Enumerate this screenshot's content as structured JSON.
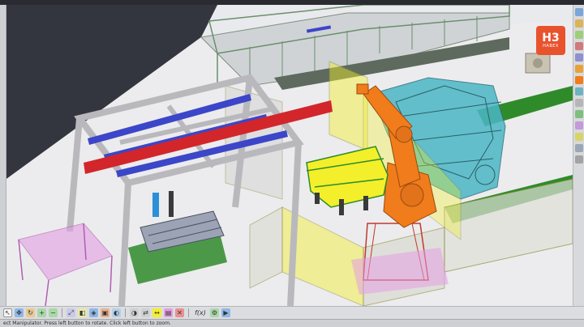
{
  "logo": {
    "mark": "H3",
    "caption": "HABEX"
  },
  "status_bar": {
    "text": "ect Manipulator. Press left button to rotate. Click left button to zoom."
  },
  "bottom_toolbar": {
    "icons": [
      "select-icon",
      "pan-icon",
      "rotate-icon",
      "zoom-in-icon",
      "zoom-out-icon",
      "fit-all-icon",
      "normal-view-icon",
      "iso-view-icon",
      "front-view-icon",
      "shading-icon",
      "hide-show-icon",
      "swap-visible-icon",
      "measure-icon",
      "section-icon",
      "clash-icon",
      "simulation-icon",
      "play-icon"
    ],
    "fx_label": "f(x)"
  },
  "right_toolbar": {
    "icons": [
      "tree-icon",
      "part-icon",
      "product-icon",
      "constraint-icon",
      "snap-icon",
      "move-icon",
      "robot-icon",
      "path-icon",
      "tag-icon",
      "program-icon",
      "device-icon",
      "analysis-icon",
      "output-icon",
      "settings-icon"
    ]
  },
  "scene": {
    "description_colors": {
      "background": "#e9eaed",
      "floor": "#eeeeef",
      "dark_wall": "#34363f",
      "robot": "#f07c1c",
      "fixture_yellow": "#f3ef2a",
      "safety_fence": "#d8d38a",
      "car_body": "#4bb7c6",
      "conveyor_green": "#2f8b2a",
      "rail_blue": "#3c46c8",
      "rail_red": "#d2262b",
      "frame_gray": "#c8c8cc",
      "cart_pink": "#e39ee3"
    }
  }
}
